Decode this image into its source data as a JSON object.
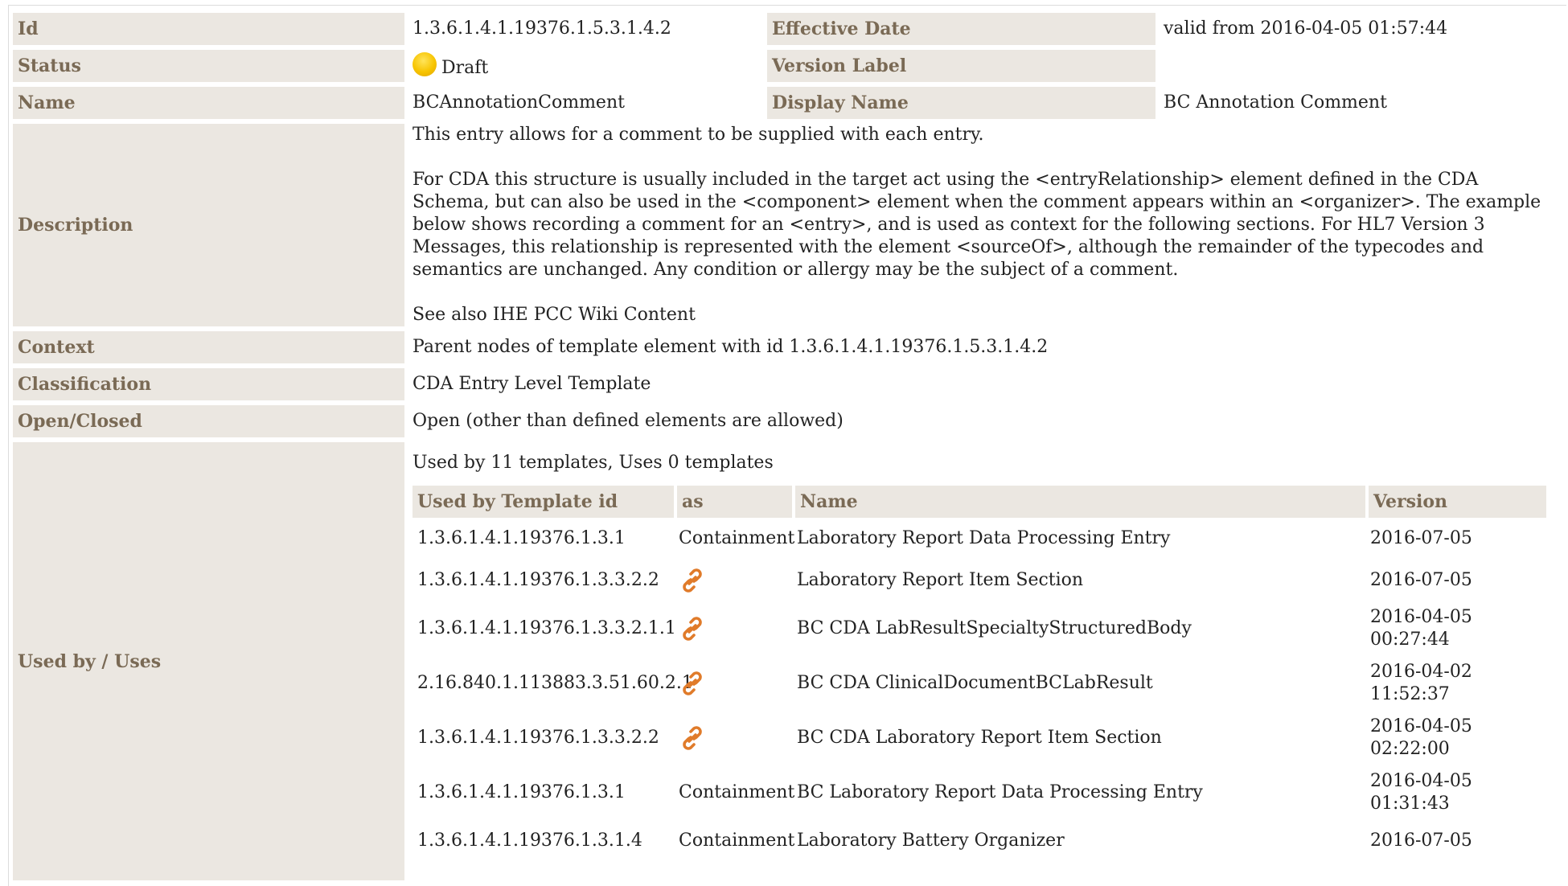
{
  "rows": {
    "id": {
      "label": "Id",
      "value": "1.3.6.1.4.1.19376.1.5.3.1.4.2"
    },
    "effective_date": {
      "label": "Effective Date",
      "value": "valid from 2016-04-05 01:57:44"
    },
    "status": {
      "label": "Status",
      "value": "Draft",
      "color": "#f7c400"
    },
    "version_label": {
      "label": "Version Label",
      "value": ""
    },
    "name": {
      "label": "Name",
      "value": "BCAnnotationComment"
    },
    "display_name": {
      "label": "Display Name",
      "value": "BC Annotation Comment"
    },
    "description": {
      "label": "Description",
      "p1": "This entry allows for a comment to be supplied with each entry.",
      "p2": "For CDA this structure is usually included in the target act using the <entryRelationship> element defined in the CDA Schema, but can also be used in the <component> element when the comment appears within an <organizer>. The example below shows recording a comment for an <entry>, and is used as context for the following sections. For HL7 Version 3 Messages, this relationship is represented with the element <sourceOf>, although the remainder of the typecodes and semantics are unchanged. Any condition or allergy may be the subject of a comment.",
      "p3": "See also IHE PCC Wiki Content"
    },
    "context": {
      "label": "Context",
      "value": "Parent nodes of template element with id 1.3.6.1.4.1.19376.1.5.3.1.4.2"
    },
    "classification": {
      "label": "Classification",
      "value": "CDA Entry Level Template"
    },
    "open_closed": {
      "label": "Open/Closed",
      "value": "Open (other than defined elements are allowed)"
    },
    "used_by": {
      "label": "Used by / Uses",
      "summary": "Used by 11 templates, Uses 0 templates"
    }
  },
  "usage_table": {
    "headers": [
      "Used by Template id",
      "as",
      "Name",
      "Version"
    ],
    "rows": [
      {
        "id": "1.3.6.1.4.1.19376.1.3.1",
        "as": "Containment",
        "as_icon": "",
        "name": "Laboratory Report Data Processing Entry",
        "version": "2016-07-05"
      },
      {
        "id": "1.3.6.1.4.1.19376.1.3.3.2.2",
        "as": "",
        "as_icon": "link-icon",
        "name": "Laboratory Report Item Section",
        "version": "2016-07-05"
      },
      {
        "id": "1.3.6.1.4.1.19376.1.3.3.2.1.1",
        "as": "",
        "as_icon": "link-icon",
        "name": "BC CDA LabResultSpecialtyStructuredBody",
        "version": "2016-04-05 00:27:44"
      },
      {
        "id": "2.16.840.1.113883.3.51.60.2.1",
        "as": "",
        "as_icon": "link-icon",
        "name": "BC CDA ClinicalDocumentBCLabResult",
        "version": "2016-04-02 11:52:37"
      },
      {
        "id": "1.3.6.1.4.1.19376.1.3.3.2.2",
        "as": "",
        "as_icon": "link-icon",
        "name": "BC CDA Laboratory Report Item Section",
        "version": "2016-04-05 02:22:00"
      },
      {
        "id": "1.3.6.1.4.1.19376.1.3.1",
        "as": "Containment",
        "as_icon": "",
        "name": "BC Laboratory Report Data Processing Entry",
        "version": "2016-04-05 01:31:43"
      },
      {
        "id": "1.3.6.1.4.1.19376.1.3.1.4",
        "as": "Containment",
        "as_icon": "",
        "name": "Laboratory Battery Organizer",
        "version": "2016-07-05"
      }
    ]
  },
  "colors": {
    "label_bg": "#ebe7e1",
    "label_text": "#7a6a55",
    "link_icon": "#e07b2a"
  }
}
